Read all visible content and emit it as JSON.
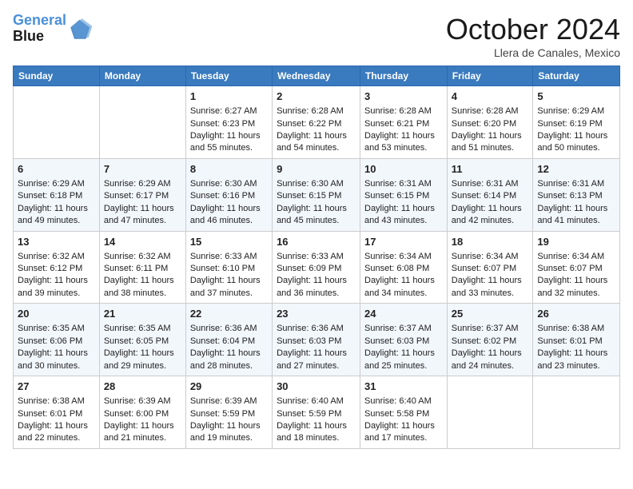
{
  "header": {
    "logo_line1": "General",
    "logo_line2": "Blue",
    "month_title": "October 2024",
    "location": "Llera de Canales, Mexico"
  },
  "weekdays": [
    "Sunday",
    "Monday",
    "Tuesday",
    "Wednesday",
    "Thursday",
    "Friday",
    "Saturday"
  ],
  "weeks": [
    [
      {
        "day": "",
        "info": ""
      },
      {
        "day": "",
        "info": ""
      },
      {
        "day": "1",
        "info": "Sunrise: 6:27 AM\nSunset: 6:23 PM\nDaylight: 11 hours and 55 minutes."
      },
      {
        "day": "2",
        "info": "Sunrise: 6:28 AM\nSunset: 6:22 PM\nDaylight: 11 hours and 54 minutes."
      },
      {
        "day": "3",
        "info": "Sunrise: 6:28 AM\nSunset: 6:21 PM\nDaylight: 11 hours and 53 minutes."
      },
      {
        "day": "4",
        "info": "Sunrise: 6:28 AM\nSunset: 6:20 PM\nDaylight: 11 hours and 51 minutes."
      },
      {
        "day": "5",
        "info": "Sunrise: 6:29 AM\nSunset: 6:19 PM\nDaylight: 11 hours and 50 minutes."
      }
    ],
    [
      {
        "day": "6",
        "info": "Sunrise: 6:29 AM\nSunset: 6:18 PM\nDaylight: 11 hours and 49 minutes."
      },
      {
        "day": "7",
        "info": "Sunrise: 6:29 AM\nSunset: 6:17 PM\nDaylight: 11 hours and 47 minutes."
      },
      {
        "day": "8",
        "info": "Sunrise: 6:30 AM\nSunset: 6:16 PM\nDaylight: 11 hours and 46 minutes."
      },
      {
        "day": "9",
        "info": "Sunrise: 6:30 AM\nSunset: 6:15 PM\nDaylight: 11 hours and 45 minutes."
      },
      {
        "day": "10",
        "info": "Sunrise: 6:31 AM\nSunset: 6:15 PM\nDaylight: 11 hours and 43 minutes."
      },
      {
        "day": "11",
        "info": "Sunrise: 6:31 AM\nSunset: 6:14 PM\nDaylight: 11 hours and 42 minutes."
      },
      {
        "day": "12",
        "info": "Sunrise: 6:31 AM\nSunset: 6:13 PM\nDaylight: 11 hours and 41 minutes."
      }
    ],
    [
      {
        "day": "13",
        "info": "Sunrise: 6:32 AM\nSunset: 6:12 PM\nDaylight: 11 hours and 39 minutes."
      },
      {
        "day": "14",
        "info": "Sunrise: 6:32 AM\nSunset: 6:11 PM\nDaylight: 11 hours and 38 minutes."
      },
      {
        "day": "15",
        "info": "Sunrise: 6:33 AM\nSunset: 6:10 PM\nDaylight: 11 hours and 37 minutes."
      },
      {
        "day": "16",
        "info": "Sunrise: 6:33 AM\nSunset: 6:09 PM\nDaylight: 11 hours and 36 minutes."
      },
      {
        "day": "17",
        "info": "Sunrise: 6:34 AM\nSunset: 6:08 PM\nDaylight: 11 hours and 34 minutes."
      },
      {
        "day": "18",
        "info": "Sunrise: 6:34 AM\nSunset: 6:07 PM\nDaylight: 11 hours and 33 minutes."
      },
      {
        "day": "19",
        "info": "Sunrise: 6:34 AM\nSunset: 6:07 PM\nDaylight: 11 hours and 32 minutes."
      }
    ],
    [
      {
        "day": "20",
        "info": "Sunrise: 6:35 AM\nSunset: 6:06 PM\nDaylight: 11 hours and 30 minutes."
      },
      {
        "day": "21",
        "info": "Sunrise: 6:35 AM\nSunset: 6:05 PM\nDaylight: 11 hours and 29 minutes."
      },
      {
        "day": "22",
        "info": "Sunrise: 6:36 AM\nSunset: 6:04 PM\nDaylight: 11 hours and 28 minutes."
      },
      {
        "day": "23",
        "info": "Sunrise: 6:36 AM\nSunset: 6:03 PM\nDaylight: 11 hours and 27 minutes."
      },
      {
        "day": "24",
        "info": "Sunrise: 6:37 AM\nSunset: 6:03 PM\nDaylight: 11 hours and 25 minutes."
      },
      {
        "day": "25",
        "info": "Sunrise: 6:37 AM\nSunset: 6:02 PM\nDaylight: 11 hours and 24 minutes."
      },
      {
        "day": "26",
        "info": "Sunrise: 6:38 AM\nSunset: 6:01 PM\nDaylight: 11 hours and 23 minutes."
      }
    ],
    [
      {
        "day": "27",
        "info": "Sunrise: 6:38 AM\nSunset: 6:01 PM\nDaylight: 11 hours and 22 minutes."
      },
      {
        "day": "28",
        "info": "Sunrise: 6:39 AM\nSunset: 6:00 PM\nDaylight: 11 hours and 21 minutes."
      },
      {
        "day": "29",
        "info": "Sunrise: 6:39 AM\nSunset: 5:59 PM\nDaylight: 11 hours and 19 minutes."
      },
      {
        "day": "30",
        "info": "Sunrise: 6:40 AM\nSunset: 5:59 PM\nDaylight: 11 hours and 18 minutes."
      },
      {
        "day": "31",
        "info": "Sunrise: 6:40 AM\nSunset: 5:58 PM\nDaylight: 11 hours and 17 minutes."
      },
      {
        "day": "",
        "info": ""
      },
      {
        "day": "",
        "info": ""
      }
    ]
  ]
}
